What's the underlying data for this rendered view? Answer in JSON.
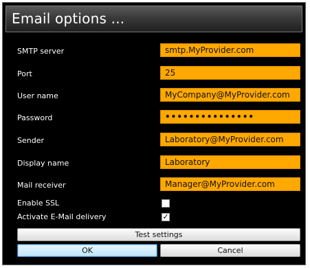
{
  "window": {
    "title": "Email options ..."
  },
  "form": {
    "smtp_server": {
      "label": "SMTP server",
      "value": "smtp.MyProvider.com"
    },
    "port": {
      "label": "Port",
      "value": "25"
    },
    "user_name": {
      "label": "User name",
      "value": "MyCompany@MyProvider.com"
    },
    "password": {
      "label": "Password",
      "value": "•••••••••••••••"
    },
    "sender": {
      "label": "Sender",
      "value": "Laboratory@MyProvider.com"
    },
    "display_name": {
      "label": "Display name",
      "value": "Laboratory"
    },
    "mail_receiver": {
      "label": "Mail receiver",
      "value": "Manager@MyProvider.com"
    },
    "enable_ssl": {
      "label": "Enable SSL",
      "checked": false,
      "mark": ""
    },
    "activate_delivery": {
      "label": "Activate E-Mail delivery",
      "checked": true,
      "mark": "✓"
    }
  },
  "buttons": {
    "test_settings": "Test settings",
    "ok": "OK",
    "cancel": "Cancel"
  },
  "colors": {
    "field_bg": "#ffa800",
    "dialog_bg": "#000000",
    "label_text": "#ffffff"
  }
}
